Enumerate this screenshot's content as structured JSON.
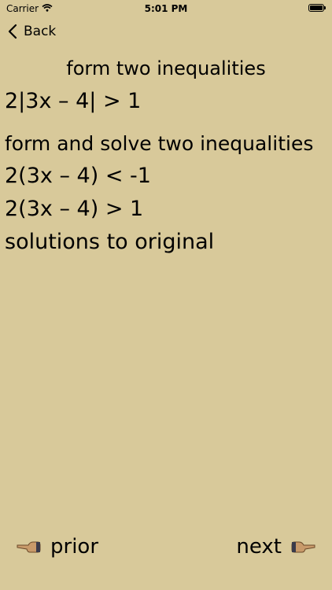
{
  "status": {
    "carrier": "Carrier",
    "time": "5:01 PM"
  },
  "nav": {
    "back_label": "Back"
  },
  "content": {
    "title": "form two inequalities",
    "expression": "2|3x – 4| > 1",
    "lines": [
      "form and solve two inequalities",
      "2(3x – 4) < -1",
      "2(3x – 4) > 1",
      "solutions to original"
    ]
  },
  "footer": {
    "prior_label": "prior",
    "next_label": "next"
  }
}
